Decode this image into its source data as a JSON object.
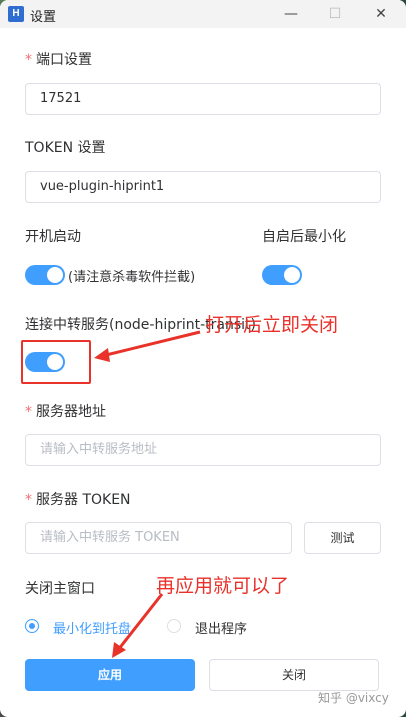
{
  "window": {
    "icon_text": "H",
    "title": "设置",
    "min_glyph": "—",
    "max_glyph": "☐",
    "close_glyph": "✕"
  },
  "form": {
    "port": {
      "required_mark": "*",
      "label": "端口设置",
      "value": "17521"
    },
    "token": {
      "label": "TOKEN 设置",
      "value": "vue-plugin-hiprint1"
    },
    "autostart": {
      "label": "开机启动",
      "enabled": true,
      "hint": "(请注意杀毒软件拦截)"
    },
    "minimize_after_start": {
      "label": "自启后最小化",
      "enabled": true
    },
    "relay": {
      "label": "连接中转服务(node-hiprint-transit)",
      "enabled": true
    },
    "server_address": {
      "required_mark": "*",
      "label": "服务器地址",
      "placeholder": "请输入中转服务地址"
    },
    "server_token": {
      "required_mark": "*",
      "label": "服务器 TOKEN",
      "placeholder": "请输入中转服务 TOKEN",
      "test_label": "测试"
    },
    "close_main": {
      "label": "关闭主窗口",
      "options": [
        {
          "label": "最小化到托盘",
          "selected": true
        },
        {
          "label": "退出程序",
          "selected": false
        }
      ]
    }
  },
  "footer": {
    "apply_label": "应用",
    "close_label": "关闭"
  },
  "annotations": {
    "note1": "打开后立即关闭",
    "note2": "再应用就可以了",
    "color": "#e8322a"
  },
  "watermark": "知乎 @vixcy",
  "colors": {
    "accent": "#409eff",
    "required": "#f56c6c"
  }
}
